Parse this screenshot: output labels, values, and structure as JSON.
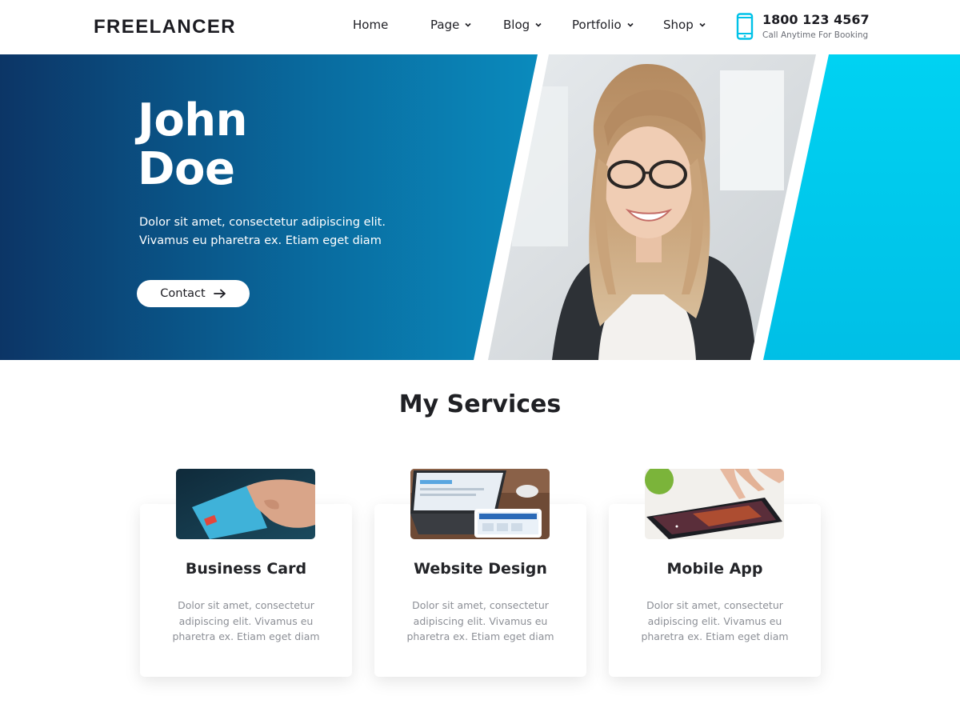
{
  "header": {
    "logo": "FREELANCER",
    "nav": [
      {
        "label": "Home",
        "has_dropdown": false
      },
      {
        "label": "Page",
        "has_dropdown": true
      },
      {
        "label": "Blog",
        "has_dropdown": true
      },
      {
        "label": "Portfolio",
        "has_dropdown": true
      },
      {
        "label": "Shop",
        "has_dropdown": true
      }
    ],
    "phone_number": "1800 123 4567",
    "phone_caption": "Call Anytime For Booking",
    "phone_icon": "smartphone-icon",
    "accent_color": "#00c2e8"
  },
  "hero": {
    "title_line1": "John",
    "title_line2": "Doe",
    "description": "Dolor sit amet, consectetur adipiscing elit. Vivamus eu pharetra ex. Etiam eget diam",
    "button_label": "Contact",
    "button_icon": "arrow-right-icon",
    "gradient_start": "#0c3566",
    "gradient_end": "#0a8ec0",
    "accent_panel_color": "#00c9ee"
  },
  "services": {
    "title": "My Services",
    "items": [
      {
        "title": "Business Card",
        "text": "Dolor sit amet, consectetur adipiscing elit. Vivamus eu pharetra ex. Etiam eget diam"
      },
      {
        "title": "Website Design",
        "text": "Dolor sit amet, consectetur adipiscing elit. Vivamus eu pharetra ex. Etiam eget diam"
      },
      {
        "title": "Mobile App",
        "text": "Dolor sit amet, consectetur adipiscing elit. Vivamus eu pharetra ex. Etiam eget diam"
      }
    ]
  }
}
